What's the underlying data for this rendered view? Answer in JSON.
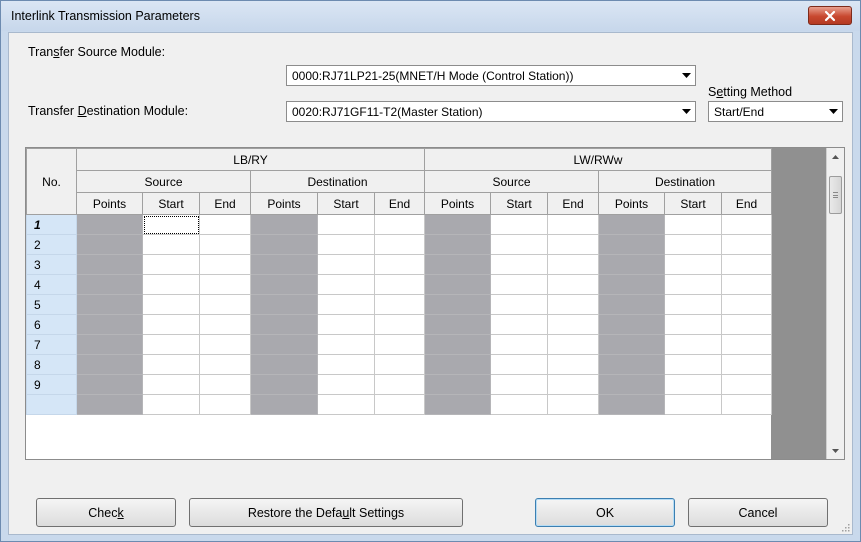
{
  "window": {
    "title": "Interlink Transmission Parameters",
    "close_label": "✕"
  },
  "source": {
    "label_pre": "Tran",
    "label_accel": "s",
    "label_post": "fer Source Module:",
    "value": "0000:RJ71LP21-25(MNET/H Mode (Control Station))"
  },
  "destination": {
    "label_pre": "Transfer ",
    "label_accel": "D",
    "label_post": "estination Module:",
    "value": "0020:RJ71GF11-T2(Master Station)"
  },
  "setting_method": {
    "label_pre": "S",
    "label_accel": "e",
    "label_post": "tting Method",
    "value": "Start/End"
  },
  "grid": {
    "no_header": "No.",
    "group1": "LB/RY",
    "group2": "LW/RWw",
    "source": "Source",
    "destination": "Destination",
    "col_points": "Points",
    "col_start": "Start",
    "col_end": "End",
    "rows": [
      "1",
      "2",
      "3",
      "4",
      "5",
      "6",
      "7",
      "8",
      "9"
    ]
  },
  "buttons": {
    "check_pre": "Chec",
    "check_accel": "k",
    "check_post": "",
    "restore_pre": "Restore the Defa",
    "restore_accel": "u",
    "restore_post": "lt Settings",
    "ok": "OK",
    "cancel": "Cancel"
  },
  "colors": {
    "gray_cell": "#a9a9ae",
    "rownum_bg": "#d5e6f7",
    "close_red": "#c8482f"
  },
  "icons": {
    "close": "close-icon",
    "dropdown": "chevron-down-icon",
    "scroll_up": "scroll-up-icon",
    "scroll_down": "scroll-down-icon"
  }
}
